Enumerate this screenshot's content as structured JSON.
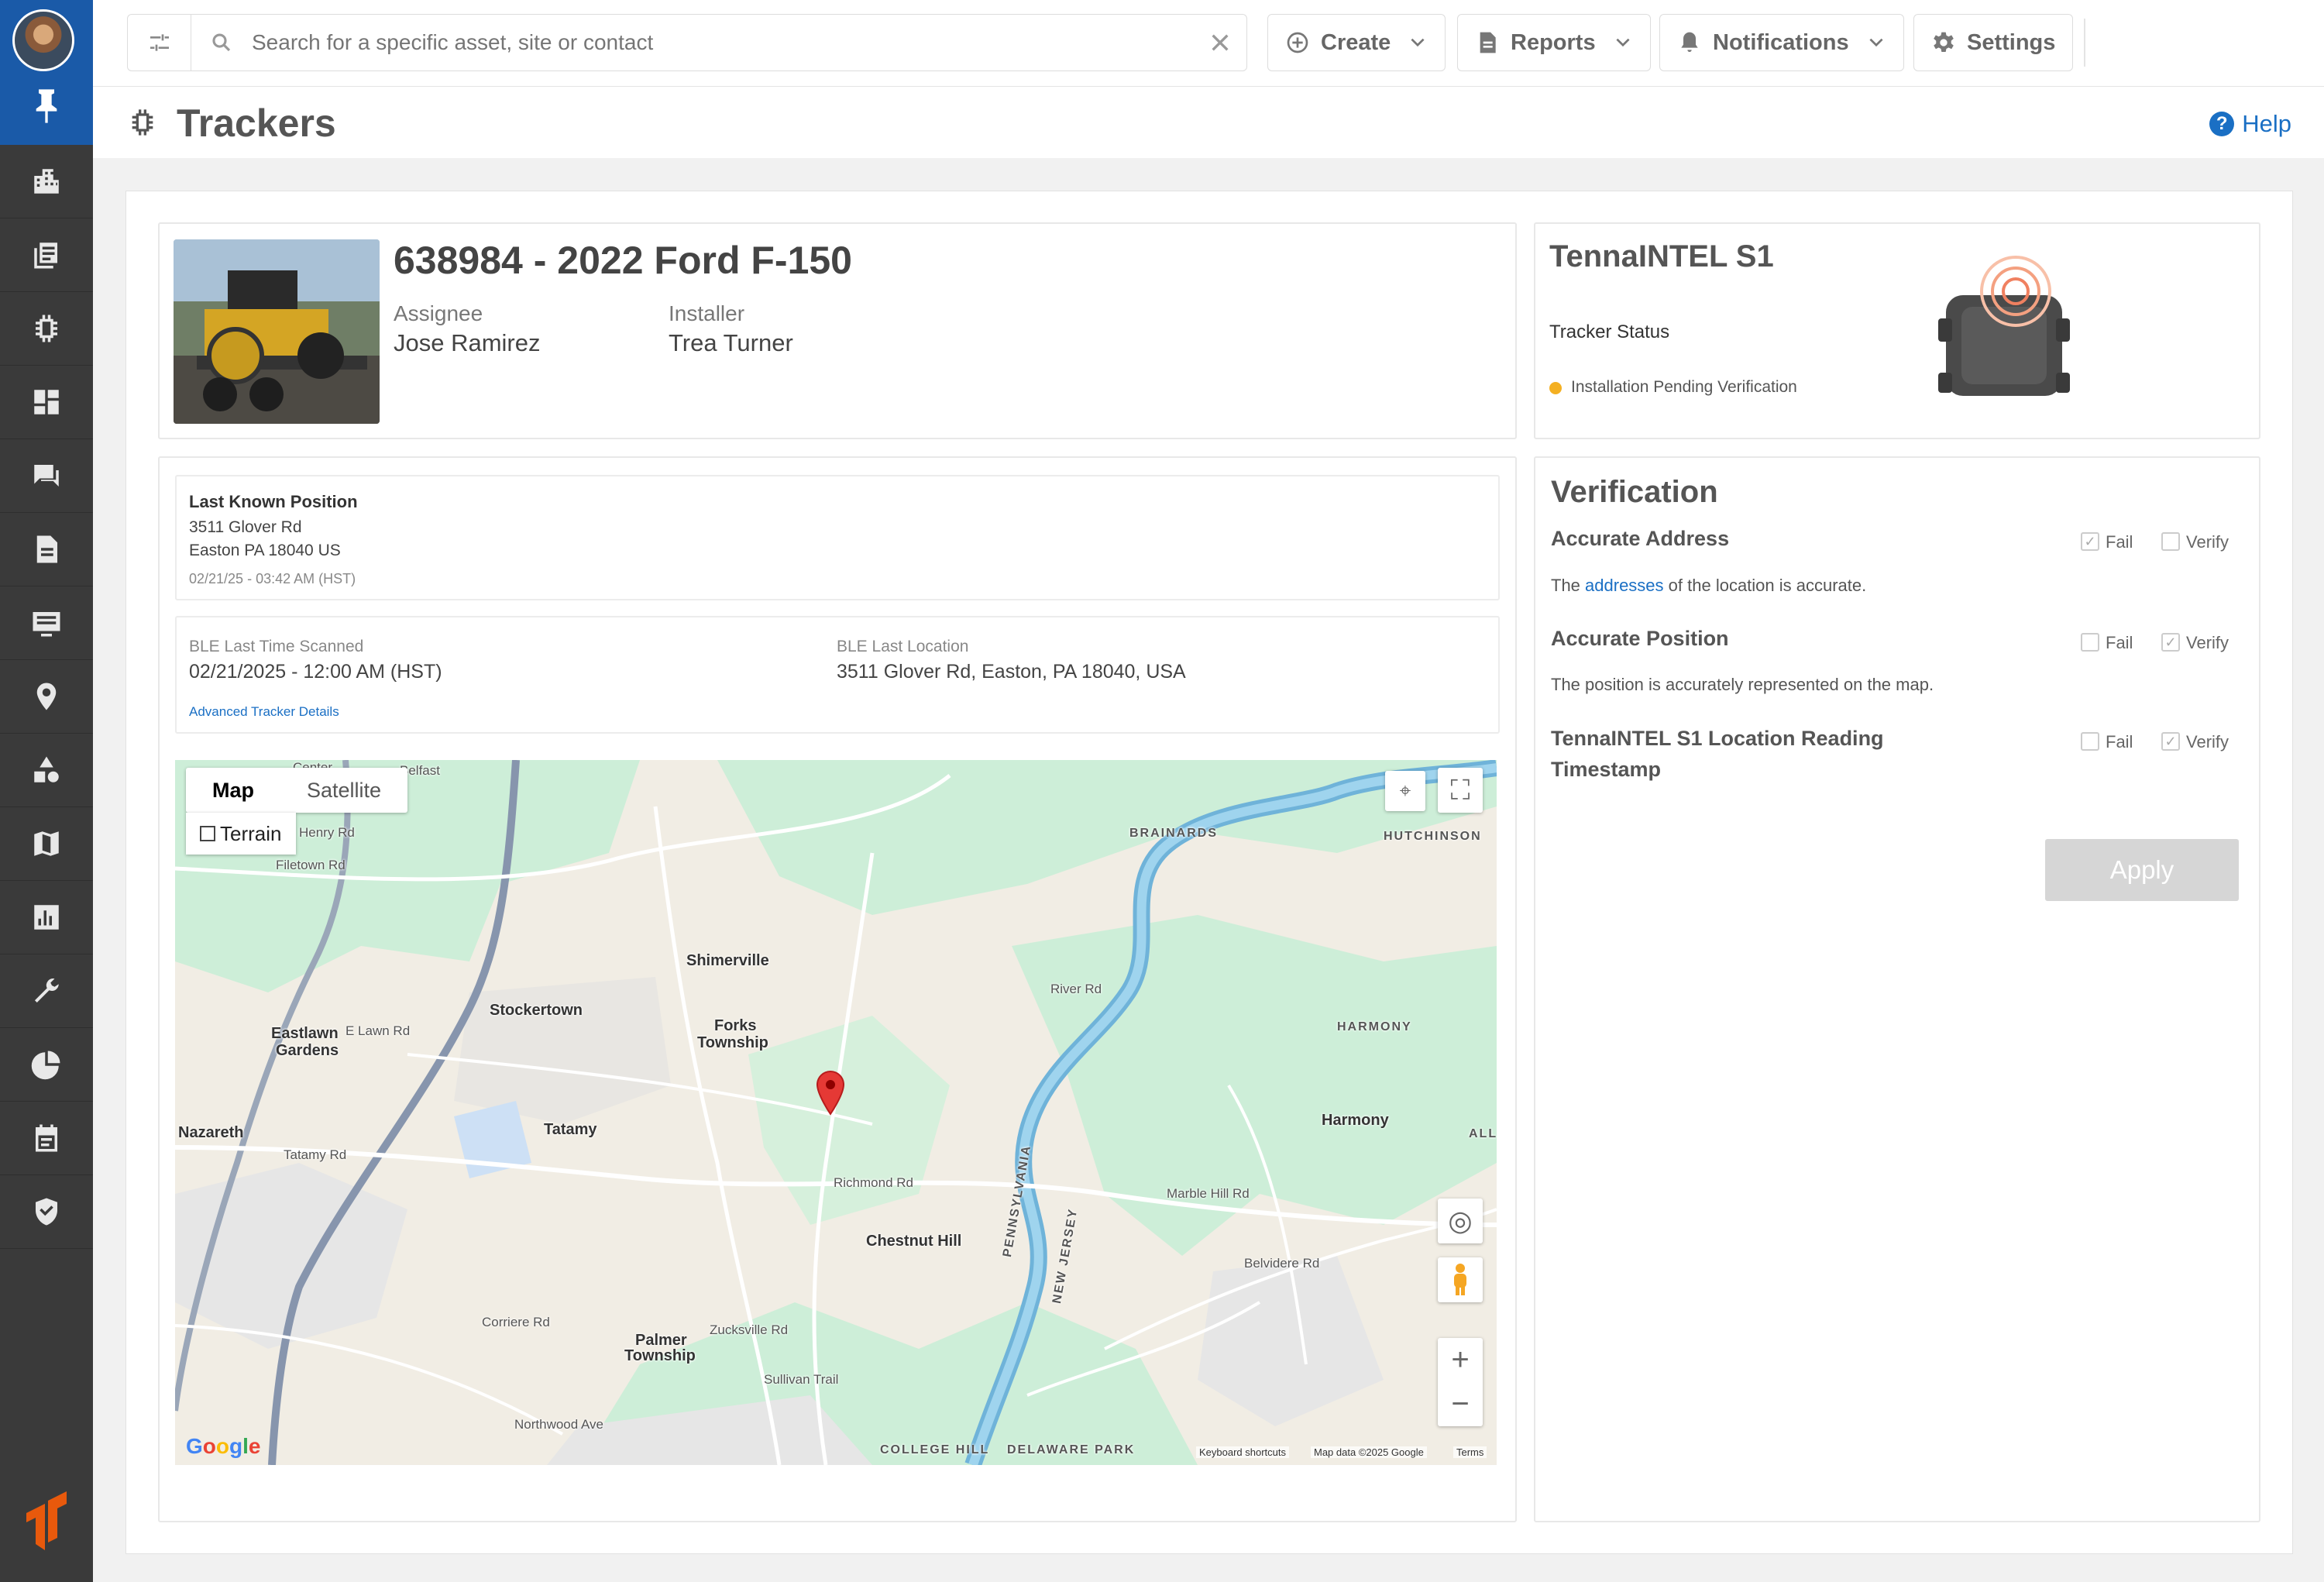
{
  "sidebar": {
    "items": [
      "buildings-icon",
      "documents-icon",
      "chip-icon",
      "dashboard-icon",
      "chat-icon",
      "file-icon",
      "list-icon",
      "location-icon",
      "shapes-icon",
      "map-icon",
      "chart-icon",
      "wrench-icon",
      "pie-icon",
      "calendar-icon",
      "shield-icon"
    ]
  },
  "topbar": {
    "search_placeholder": "Search for a specific asset, site or contact",
    "create_label": "Create",
    "reports_label": "Reports",
    "notifications_label": "Notifications",
    "settings_label": "Settings"
  },
  "page": {
    "title": "Trackers",
    "help_label": "Help"
  },
  "asset": {
    "title": "638984 - 2022 Ford F-150",
    "assignee_label": "Assignee",
    "assignee": "Jose Ramirez",
    "installer_label": "Installer",
    "installer": "Trea Turner"
  },
  "tracker": {
    "name": "TennaINTEL S1",
    "status_label": "Tracker Status",
    "status": "Installation Pending Verification",
    "status_color": "#f4b022"
  },
  "position": {
    "title": "Last Known Position",
    "street": "3511 Glover Rd",
    "city": "Easton PA 18040 US",
    "timestamp": "02/21/25 - 03:42 AM (HST)",
    "ble_time_label": "BLE Last Time Scanned",
    "ble_time": "02/21/2025 - 12:00 AM (HST)",
    "ble_location_label": "BLE Last Location",
    "ble_location": "3511 Glover Rd, Easton, PA 18040, USA",
    "advanced_link": "Advanced Tracker Details"
  },
  "map": {
    "tab_map": "Map",
    "tab_satellite": "Satellite",
    "terrain_label": "Terrain",
    "labels": {
      "center": "Center",
      "belfast": "Belfast",
      "shimerville": "Shimerville",
      "stockertown": "Stockertown",
      "forks": "Forks",
      "forks2": "Township",
      "eastlawn": "Eastlawn",
      "eastlawn2": "Gardens",
      "nazareth": "Nazareth",
      "tatamy": "Tatamy",
      "chestnut": "Chestnut Hill",
      "harmony": "Harmony",
      "harmony_caps": "HARMONY",
      "brainards": "BRAINARDS",
      "hutchinson": "HUTCHINSON",
      "palmer": "Palmer",
      "palmer2": "Township",
      "college": "COLLEGE HILL",
      "delaware": "DELAWARE PARK",
      "all": "ALL",
      "penn": "PENNSYLVANIA",
      "nj": "NEW JERSEY",
      "henry": "Henry Rd",
      "filetown": "Filetown Rd",
      "lawn": "E Lawn Rd",
      "tatamy_rd": "Tatamy Rd",
      "river_rd": "River Rd",
      "richmond": "Richmond Rd",
      "sullivan": "Sullivan Trail",
      "zucksville": "Zucksville Rd",
      "corriere": "Corriere Rd",
      "northwood": "Northwood Ave",
      "belvidere": "Belvidere Rd",
      "marble": "Marble Hill Rd"
    },
    "google": "Google",
    "keyboard": "Keyboard shortcuts",
    "map_data": "Map data ©2025 Google",
    "terms": "Terms"
  },
  "verification": {
    "title": "Verification",
    "fail_label": "Fail",
    "verify_label": "Verify",
    "items": [
      {
        "title": "Accurate Address",
        "desc_pre": "The ",
        "desc_link": "addresses",
        "desc_post": " of the location is accurate."
      },
      {
        "title": "Accurate Position",
        "desc": "The position is accurately represented on the map."
      },
      {
        "title": "TennaINTEL S1 Location Reading",
        "title2": "Timestamp"
      }
    ],
    "apply_label": "Apply"
  }
}
